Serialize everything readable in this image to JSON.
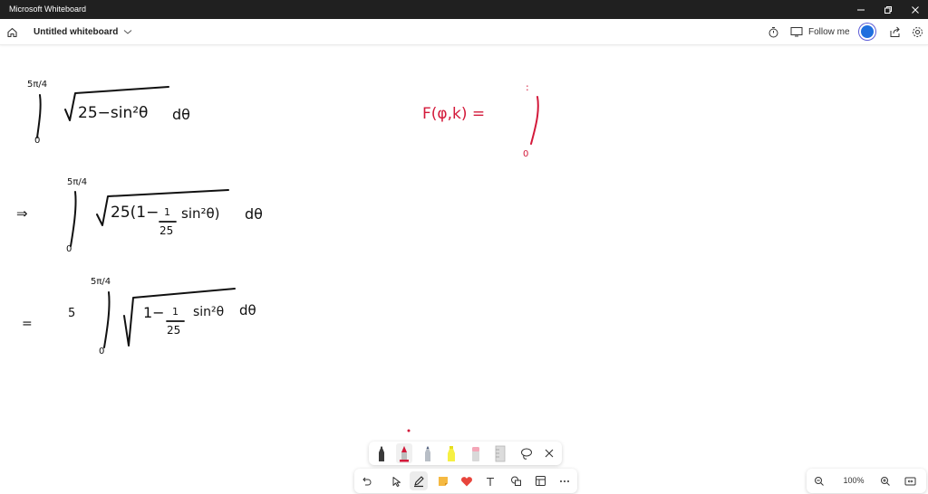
{
  "window": {
    "title": "Microsoft Whiteboard",
    "controls": [
      "minimize",
      "restore",
      "close"
    ]
  },
  "toolbar": {
    "board_name": "Untitled whiteboard",
    "follow_label": "Follow me"
  },
  "canvas": {
    "ink_color_black": "#111111",
    "ink_color_red": "#d3193a",
    "expr1": {
      "upper_limit": "5π/4",
      "lower_limit": "0",
      "integrand": "25−sin²θ",
      "differential": "dθ"
    },
    "expr2": {
      "prefix": "⇒",
      "upper_limit": "5π/4",
      "lower_limit": "0",
      "integrand_a": "25(1−",
      "frac_num": "1",
      "frac_den": "25",
      "integrand_b": "sin²θ)",
      "differential": "dθ"
    },
    "expr3": {
      "prefix": "=",
      "coef": "5",
      "upper_limit": "5π/4",
      "lower_limit": "0",
      "integrand_a": "1−",
      "frac_num": "1",
      "frac_den": "25",
      "integrand_b": "sin²θ",
      "differential": "dθ"
    },
    "expr4": {
      "lhs": "F(φ,k) =",
      "upper_limit": ":",
      "lower_limit": "0"
    }
  },
  "pen_palette": {
    "tools": [
      "black-pen",
      "red-pen",
      "gray-pen",
      "yellow-highlighter",
      "pink-eraser",
      "ruler",
      "lasso-select",
      "close"
    ],
    "selected_color": "#d3193a"
  },
  "main_tools": {
    "tools": [
      "undo",
      "select",
      "pen",
      "sticky-note",
      "reactions",
      "text",
      "shapes",
      "templates",
      "more"
    ],
    "active": "pen"
  },
  "zoom": {
    "value": "100%"
  }
}
